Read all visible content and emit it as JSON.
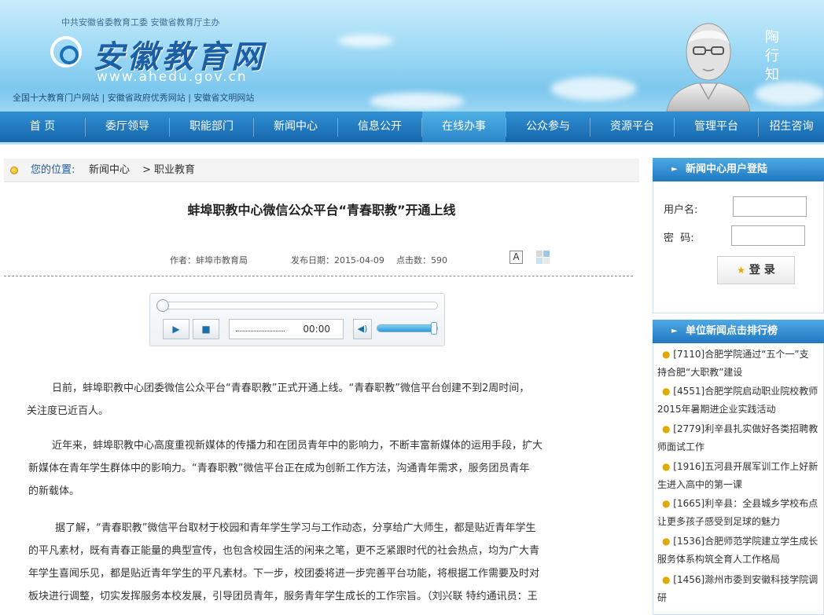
{
  "header": {
    "sponsor": "中共安徽省委教育工委 安徽省教育厅主办",
    "logo_text": "安徽教育网",
    "logo_url": "www.ahedu.gov.cn",
    "honors": "全国十大教育门户网站 | 安徽省政府优秀网站 | 安徽省文明网站",
    "portrait_name": "陶行知"
  },
  "nav": {
    "items": [
      "首 页",
      "委厅领导",
      "职能部门",
      "新闻中心",
      "信息公开",
      "在线办事",
      "公众参与",
      "资源平台",
      "管理平台",
      "招生咨询"
    ],
    "active_index": 5
  },
  "breadcrumb": {
    "label": "您的位置:",
    "path1": "新闻中心",
    "path2": "> 职业教育"
  },
  "article": {
    "title": "蚌埠职教中心微信公众平台“青春职教”开通上线",
    "author": "作者：蚌埠市教育局",
    "date": "发布日期：2015-04-09",
    "clicks": "点击数：590",
    "font_button": "A",
    "paragraphs": [
      [
        "日前，蚌埠职教中心团委微信公众平台“青春职教”正式开通上线。“青春职教”微信平台创建不到2周时间，",
        "关注度已近百人。"
      ],
      [
        "近年来，蚌埠职教中心高度重视新媒体的传播力和在团员青年中的影响力，不断丰富新媒体的运用手段，扩大",
        "新媒体在青年学生群体中的影响力。“青春职教”微信平台正在成为创新工作方法，沟通青年需求，服务团员青年",
        "的新载体。"
      ],
      [
        "据了解，“青春职教”微信平台取材于校园和青年学生学习与工作动态，分享给广大师生，都是贴近青年学生",
        "的平凡素材，既有青春正能量的典型宣传，也包含校园生活的闲来之笔，更不乏紧跟时代的社会热点，均为广大青",
        "年学生喜闻乐见，都是贴近青年学生的平凡素材。下一步，校团委将进一步完善平台功能，将根据工作需要及时对",
        "板块进行调整，切实发挥服务本校发展，引导团员青年，服务青年学生成长的工作宗旨。（刘兴联 特约通讯员：王"
      ]
    ]
  },
  "player": {
    "time": "00:00",
    "progress": 0,
    "volume": 0.95
  },
  "login": {
    "heading": "新闻中心用户登陆",
    "username_label": "用户名:",
    "password_label": "密  码:",
    "submit": "登 录"
  },
  "ranking": {
    "heading": "单位新闻点击排行榜",
    "items": [
      {
        "count": "[7110]",
        "line1": "合肥学院通过“五个一”支",
        "line2": "持合肥“大职教”建设"
      },
      {
        "count": "[4551]",
        "line1": "合肥学院启动职业院校教师",
        "line2": "2015年暑期进企业实践活动"
      },
      {
        "count": "[2779]",
        "line1": "利辛县扎实做好各类招聘教",
        "line2": "师面试工作"
      },
      {
        "count": "[1916]",
        "line1": "五河县开展军训工作上好新",
        "line2": "生进入高中的第一课"
      },
      {
        "count": "[1665]",
        "line1": "利辛县：全县城乡学校布点",
        "line2": "让更多孩子感受到足球的魅力"
      },
      {
        "count": "[1536]",
        "line1": "合肥师范学院建立学生成长",
        "line2": "服务体系构筑全育人工作格局"
      },
      {
        "count": "[1456]",
        "line1": "滁州市委到安徽科技学院调",
        "line2": "研"
      }
    ]
  },
  "colors": {
    "nav_blue": "#1767ad",
    "link_blue": "#1b5fa6",
    "accent_gold": "#e0a800"
  }
}
